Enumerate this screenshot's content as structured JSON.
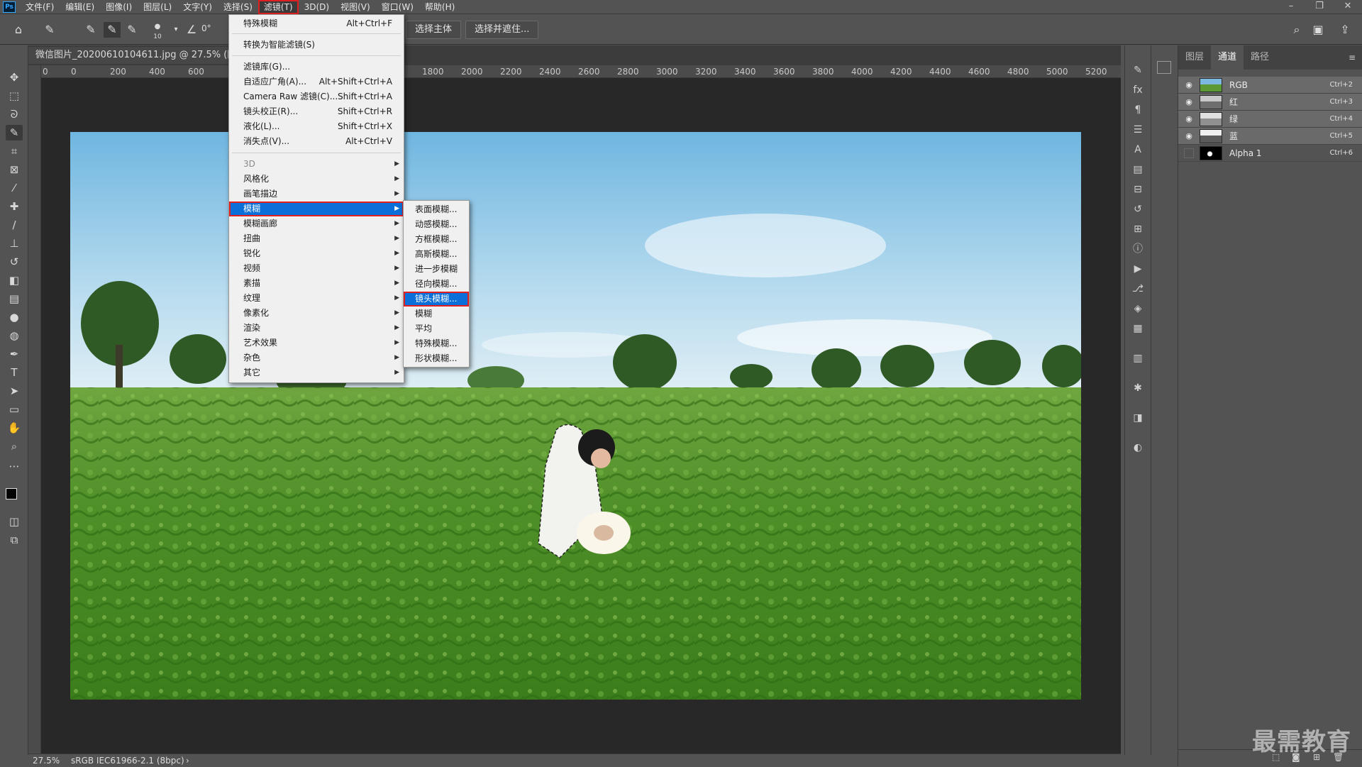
{
  "menubar": {
    "logo": "Ps",
    "items": [
      "文件(F)",
      "编辑(E)",
      "图像(I)",
      "图层(L)",
      "文字(Y)",
      "选择(S)",
      "滤镜(T)",
      "3D(D)",
      "视图(V)",
      "窗口(W)",
      "帮助(H)"
    ],
    "active_index": 6,
    "window_controls": [
      "–",
      "❐",
      "✕"
    ]
  },
  "options": {
    "brush_size": "10",
    "angle": "0°",
    "select_subject": "选择主体",
    "select_mask": "选择并遮住..."
  },
  "document": {
    "tab_title": "微信图片_20200610104611.jpg @ 27.5% (图层",
    "zoom": "27.5%",
    "color_profile": "sRGB IEC61966-2.1 (8bpc)"
  },
  "ruler": {
    "h_ticks": [
      "0",
      "0",
      "200",
      "400",
      "600",
      "1800",
      "2000",
      "2200",
      "2400",
      "2600",
      "2800",
      "3000",
      "3200",
      "3400",
      "3600",
      "3800",
      "4000",
      "4200",
      "4400",
      "4600",
      "4800",
      "5000",
      "5200"
    ]
  },
  "filter_menu": {
    "top_items": [
      {
        "label": "特殊模糊",
        "shortcut": "Alt+Ctrl+F"
      },
      {
        "label": "转换为智能滤镜(S)",
        "shortcut": ""
      }
    ],
    "gallery_items": [
      {
        "label": "滤镜库(G)...",
        "shortcut": ""
      },
      {
        "label": "自适应广角(A)...",
        "shortcut": "Alt+Shift+Ctrl+A"
      },
      {
        "label": "Camera Raw 滤镜(C)...",
        "shortcut": "Shift+Ctrl+A"
      },
      {
        "label": "镜头校正(R)...",
        "shortcut": "Shift+Ctrl+R"
      },
      {
        "label": "液化(L)...",
        "shortcut": "Shift+Ctrl+X"
      },
      {
        "label": "消失点(V)...",
        "shortcut": "Alt+Ctrl+V"
      }
    ],
    "sub_items": [
      "3D",
      "风格化",
      "画笔描边",
      "模糊",
      "模糊画廊",
      "扭曲",
      "锐化",
      "视频",
      "素描",
      "纹理",
      "像素化",
      "渲染",
      "艺术效果",
      "杂色",
      "其它"
    ],
    "disabled_index": 0,
    "highlighted_index": 3
  },
  "blur_submenu": {
    "items": [
      "表面模糊...",
      "动感模糊...",
      "方框模糊...",
      "高斯模糊...",
      "进一步模糊",
      "径向模糊...",
      "镜头模糊...",
      "模糊",
      "平均",
      "特殊模糊...",
      "形状模糊..."
    ],
    "highlighted_index": 6
  },
  "channels_panel": {
    "tabs": [
      "图层",
      "通道",
      "路径"
    ],
    "active_tab_index": 1,
    "channels": [
      {
        "name": "RGB",
        "shortcut": "Ctrl+2",
        "visible": true,
        "selected": true
      },
      {
        "name": "红",
        "shortcut": "Ctrl+3",
        "visible": true,
        "selected": true
      },
      {
        "name": "绿",
        "shortcut": "Ctrl+4",
        "visible": true,
        "selected": true
      },
      {
        "name": "蓝",
        "shortcut": "Ctrl+5",
        "visible": true,
        "selected": true
      },
      {
        "name": "Alpha 1",
        "shortcut": "Ctrl+6",
        "visible": false,
        "selected": false
      }
    ]
  },
  "watermark": "最需教育",
  "colors": {
    "menu_highlight": "#0a6fd8",
    "annotation_red": "#e02020",
    "panel_bg": "#535353"
  }
}
